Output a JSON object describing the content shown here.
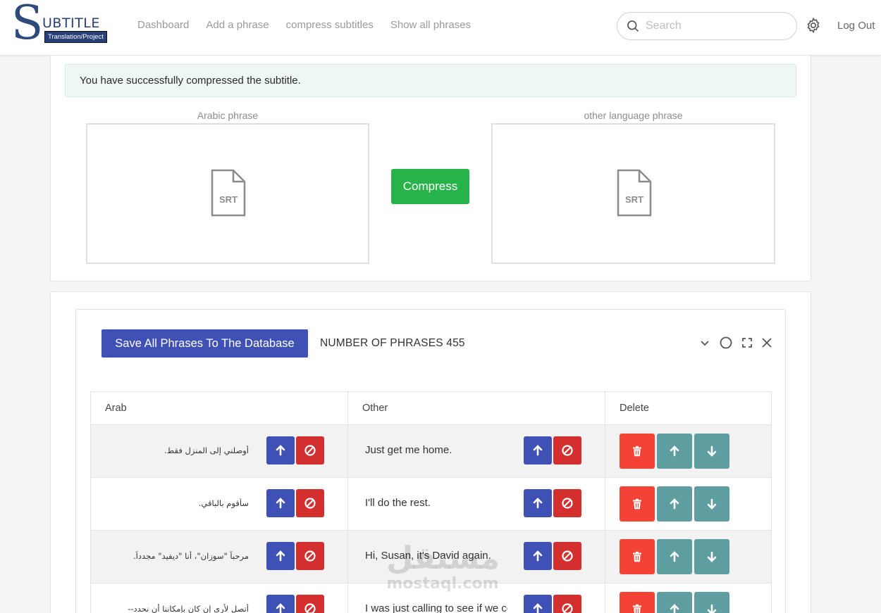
{
  "header": {
    "logo": {
      "letter": "S",
      "word": "UBTITLE",
      "tagline": "Translation/Project"
    },
    "nav": [
      "Dashboard",
      "Add a phrase",
      "compress subtitles",
      "Show all phrases"
    ],
    "search_placeholder": "Search",
    "logout_label": "Log Out"
  },
  "upload": {
    "alert": "You have successfully compressed the subtitle.",
    "arabic_label": "Arabic phrase",
    "other_label": "other language phrase",
    "file_icon_text": "SRT",
    "compress_label": "Compress"
  },
  "phrases": {
    "save_label": "Save All Phrases To The Database",
    "count_label": "NUMBER OF PHRASES 455",
    "columns": [
      "Arab",
      "Other",
      "Delete"
    ],
    "rows": [
      {
        "arab": "أوصلني إلى المنزل فقط.",
        "other": "Just get me home."
      },
      {
        "arab": "سأقوم بالباقي.",
        "other": "I'll do the rest."
      },
      {
        "arab": "مرحباً \"سوزان\"، أنا \"ديفيد\" مجدداً.",
        "other": "Hi, Susan, it's David again."
      },
      {
        "arab": "أتصل لأرى إن كان بإمكاننا أن نحدد--",
        "other": "I was just calling to see if we could"
      }
    ]
  },
  "watermark": {
    "line1": "مستقل",
    "line2": "mostaql.com"
  },
  "colors": {
    "primary": "#3f51b5",
    "danger": "#d32f2f",
    "delete": "#f44336",
    "teal": "#5f9ea0",
    "success": "#28b34a"
  }
}
